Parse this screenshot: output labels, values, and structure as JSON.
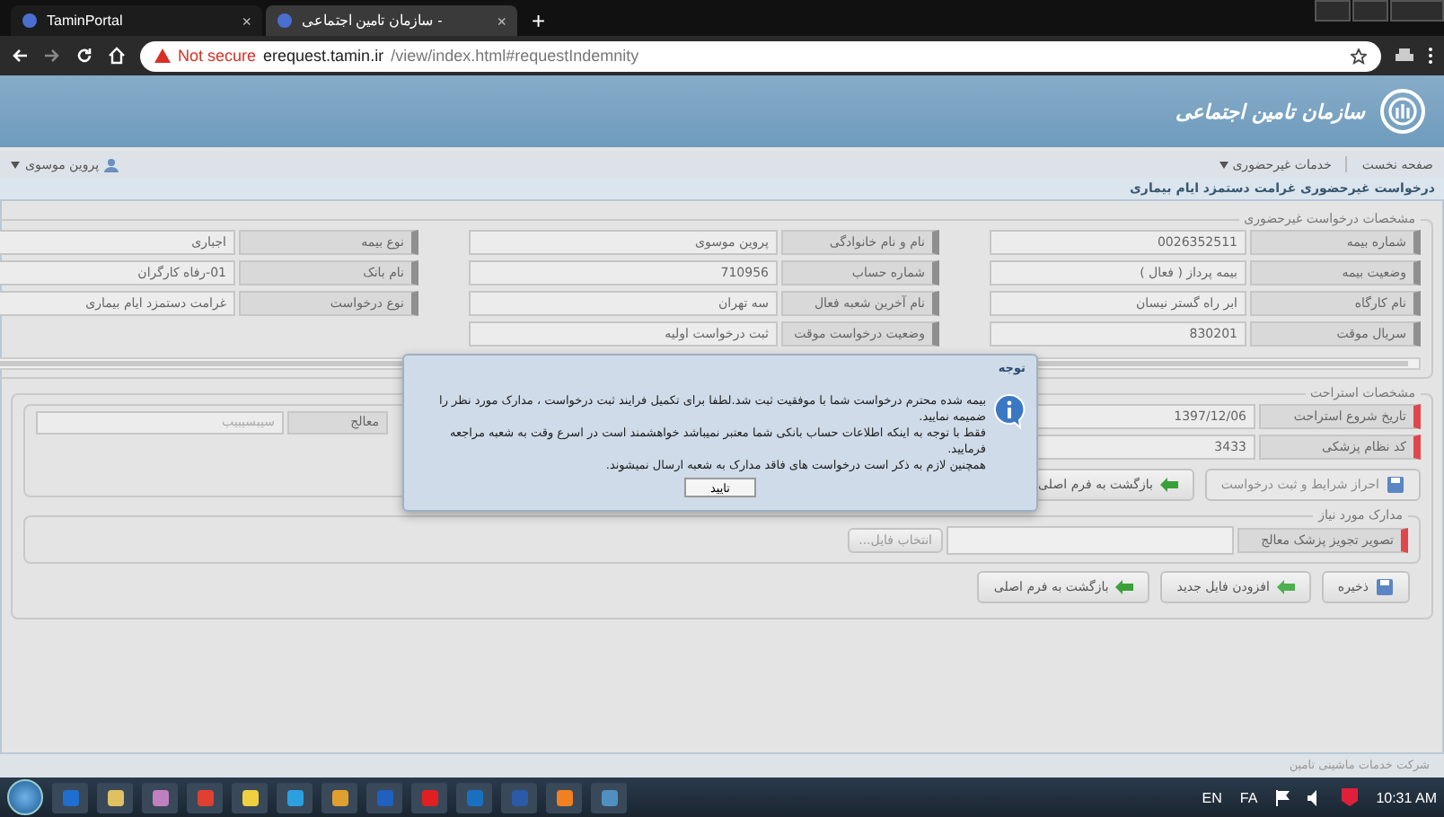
{
  "browser": {
    "left_tab": {
      "title": "TaminPortal",
      "close": "×",
      "selected": false
    },
    "right_tab": {
      "title": "سازمان تامین اجتماعی -",
      "close": "×",
      "selected": true
    },
    "new_tab": "+",
    "security": "Not secure",
    "url_host": "erequest.tamin.ir",
    "url_path": "/view/index.html#requestIndemnity"
  },
  "header": {
    "org_name": "سازمان تامین اجتماعی"
  },
  "nav": {
    "items": [
      {
        "label": "صفحه نخست",
        "dropdown": false
      },
      {
        "label": "خدمات غیرحضوری",
        "dropdown": true
      }
    ],
    "user": {
      "name": "پروین موسوی",
      "dropdown": true
    }
  },
  "page_title": "درخواست غیرحضوری غرامت دستمزد ایام بیماری",
  "request_section": {
    "legend": "مشخصات درخواست غیرحضوری",
    "columns": [
      [
        {
          "label": "شماره بیمه",
          "value": "0026352511",
          "required": false
        },
        {
          "label": "وضعیت بیمه",
          "value": "بیمه پرداز ( فعال )",
          "required": false
        },
        {
          "label": "نام کارگاه",
          "value": "ابر راه گستر نیسان",
          "required": false
        },
        {
          "label": "سریال موقت",
          "value": "830201",
          "required": false
        }
      ],
      [
        {
          "label": "نام و نام خانوادگی",
          "value": "پروین موسوی",
          "required": false
        },
        {
          "label": "شماره حساب",
          "value": "710956",
          "required": false
        },
        {
          "label": "نام آخرین شعبه فعال",
          "value": "سه تهران",
          "required": false
        },
        {
          "label": "وضعیت درخواست موقت",
          "value": "ثبت درخواست اولیه",
          "required": false
        }
      ],
      [
        {
          "label": "نوع بیمه",
          "value": "اجباری",
          "required": false
        },
        {
          "label": "نام بانک",
          "value": "01-رفاه کارگران",
          "required": false
        },
        {
          "label": "نوع درخواست",
          "value": "غرامت دستمزد ایام بیماری",
          "required": false
        }
      ]
    ]
  },
  "rest_section": {
    "legend": "مشخصات استراحت",
    "fields": [
      {
        "label": "تاریخ شروع استراحت",
        "value": "1397/12/06",
        "required": true
      },
      {
        "label": "کد نظام پزشکی",
        "value": "3433",
        "required": true
      }
    ],
    "side_field": {
      "label": "معالج",
      "value": "سیبسیبیب"
    },
    "buttons": [
      {
        "label": "احراز شرایط و ثبت درخواست",
        "kind": "save",
        "disabled": true
      },
      {
        "label": "بازگشت به فرم اصلی",
        "kind": "back",
        "disabled": false
      }
    ]
  },
  "documents_section": {
    "legend": "مدارک مورد نیاز",
    "files": [
      {
        "label": "تصویر تجویز پزشک معالج",
        "required": true,
        "button": "انتخاب فایل..."
      }
    ]
  },
  "actions": [
    {
      "label": "ذخیره",
      "kind": "save",
      "disabled": false
    },
    {
      "label": "افزودن فایل جدید",
      "kind": "add",
      "disabled": false
    },
    {
      "label": "بازگشت به فرم اصلی",
      "kind": "back",
      "disabled": false
    }
  ],
  "footer": "شرکت خدمات ماشینی تامین",
  "dialog": {
    "title": "توجه",
    "paragraphs": [
      "بیمه شده محترم درخواست شما با موفقیت ثبت شد.لطفا برای تکمیل فرایند ثبت درخواست ، مدارک مورد نظر را ضمیمه نمایید.",
      "فقط با توجه به اینکه اطلاعات حساب بانکی شما معتبر نمیباشد خواهشمند است در اسرع وقت به شعبه مراجعه فرمایید.",
      "همچنین لازم به ذکر است درخواست های فاقد مدارک به شعبه ارسال نمیشوند."
    ],
    "button": "تایید"
  },
  "taskbar": {
    "language_bar": "EN",
    "keyboard_layout": "FA",
    "clock": "10:31 AM"
  }
}
